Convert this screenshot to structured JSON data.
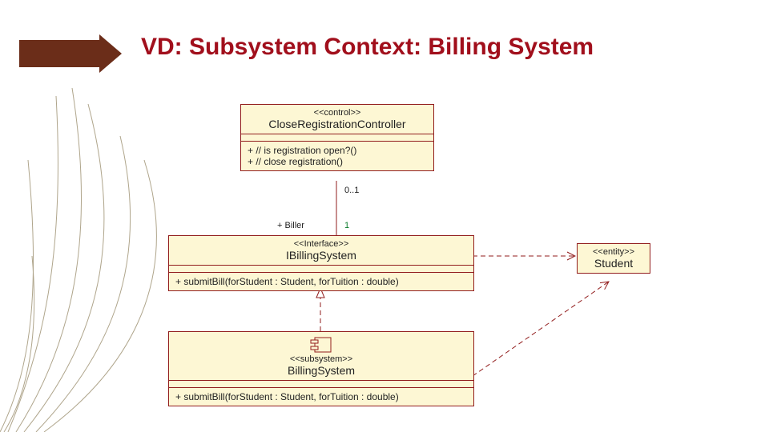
{
  "title": "VD: Subsystem Context: Billing System",
  "boxes": {
    "controller": {
      "stereo": "<<control>>",
      "name": "CloseRegistrationController",
      "ops": [
        "+ // is registration open?()",
        "+ // close registration()"
      ]
    },
    "ibilling": {
      "stereo": "<<Interface>>",
      "name": "IBillingSystem",
      "ops": [
        "+ submitBill(forStudent : Student, forTuition : double)"
      ]
    },
    "billing": {
      "stereo": "<<subsystem>>",
      "name": "BillingSystem",
      "ops": [
        "+ submitBill(forStudent : Student, forTuition : double)"
      ]
    },
    "student": {
      "stereo": "<<entity>>",
      "name": "Student"
    }
  },
  "labels": {
    "mult_top": "0..1",
    "role": "+ Biller",
    "mult_bottom": "1"
  }
}
